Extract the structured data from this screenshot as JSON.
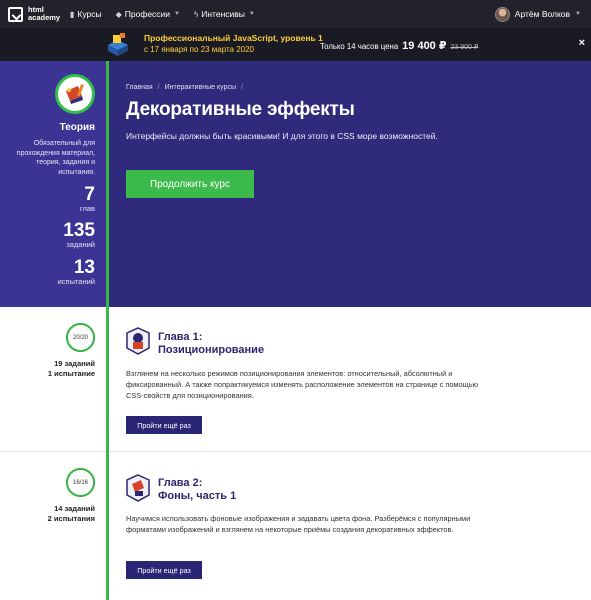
{
  "topnav": {
    "logo_text": "html academy",
    "items": [
      {
        "label": "Курсы",
        "icon": "courses-icon"
      },
      {
        "label": "Профессии",
        "icon": "professions-icon"
      },
      {
        "label": "Интенсивы",
        "icon": "lightning-icon"
      }
    ],
    "user_name": "Артём Волков"
  },
  "promo": {
    "title": "Профессиональный JavaScript, уровень 1",
    "dates": "с 17 января по 23 марта 2020",
    "offer_text": "Только 14 часов цена",
    "price": "19 400 ₽",
    "old_price": "23 900 ₽",
    "close": "×"
  },
  "sidebar": {
    "title": "Теория",
    "description": "Обязательный для прохождения материал, теория, задания и испытания.",
    "stats": [
      {
        "num": "7",
        "label": "глав"
      },
      {
        "num": "135",
        "label": "заданий"
      },
      {
        "num": "13",
        "label": "испытаний"
      }
    ]
  },
  "hero": {
    "breadcrumbs": [
      "Главная",
      "Интерактивные курсы"
    ],
    "title": "Декоративные эффекты",
    "subtitle": "Интерфейсы должны быть красивыми! И для этого в CSS море возможностей.",
    "cta": "Продолжить курс"
  },
  "chapters": [
    {
      "progress": "20/20",
      "tasks": "19 заданий",
      "tests": "1 испытание",
      "title_line1": "Глава 1:",
      "title_line2": "Позиционирование",
      "description": "Взглянем на несколько режимов позиционирования элементов: относительный, абсолютный и фиксированный. А также попрактикуемся изменять расположение элементов на странице с помощью CSS-свойств для позиционирования.",
      "button": "Пройти ещё раз"
    },
    {
      "progress": "16/16",
      "tasks": "14 заданий",
      "tests": "2 испытания",
      "title_line1": "Глава 2:",
      "title_line2": "Фоны, часть 1",
      "description": "Научимся использовать фоновые изображения и задавать цвета фона. Разберёмся с популярными форматами изображений и взглянем на некоторые приёмы создания декоративных эффектов.",
      "button": "Пройти ещё раз"
    }
  ],
  "colors": {
    "accent_green": "#3cba4c",
    "hero_bg": "#2f2a7b",
    "promo_yellow": "#ffcf3a"
  }
}
